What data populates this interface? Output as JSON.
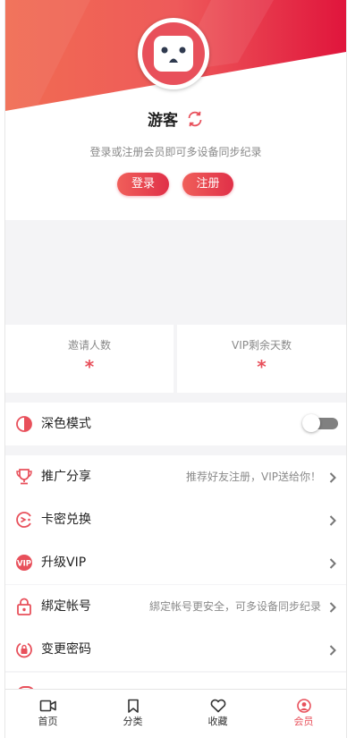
{
  "profile": {
    "username": "游客",
    "hint": "登录或注册会员即可多设备同步纪录",
    "login_label": "登录",
    "register_label": "注册"
  },
  "stats": [
    {
      "label": "邀请人数",
      "value": "*"
    },
    {
      "label": "VIP剩余天数",
      "value": "*"
    }
  ],
  "menu": {
    "dark_mode": {
      "label": "深色模式",
      "enabled": false
    },
    "items": [
      {
        "label": "推广分享",
        "desc": "推荐好友注册，VIP送给你！",
        "icon": "trophy-icon"
      },
      {
        "label": "卡密兑换",
        "desc": "",
        "icon": "card-redeem-icon"
      },
      {
        "label": "升级VIP",
        "desc": "",
        "icon": "vip-icon"
      },
      {
        "label": "綁定帐号",
        "desc": "綁定帐号更安全，可多设备同步纪录",
        "icon": "lock-icon"
      },
      {
        "label": "变更密码",
        "desc": "",
        "icon": "password-icon"
      }
    ]
  },
  "tabs": [
    {
      "label": "首页",
      "icon": "video-icon"
    },
    {
      "label": "分类",
      "icon": "bookmark-icon"
    },
    {
      "label": "收藏",
      "icon": "heart-icon"
    },
    {
      "label": "会员",
      "icon": "user-icon",
      "active": true
    }
  ],
  "colors": {
    "accent": "#e8505b",
    "accent_dark": "#e03048"
  }
}
